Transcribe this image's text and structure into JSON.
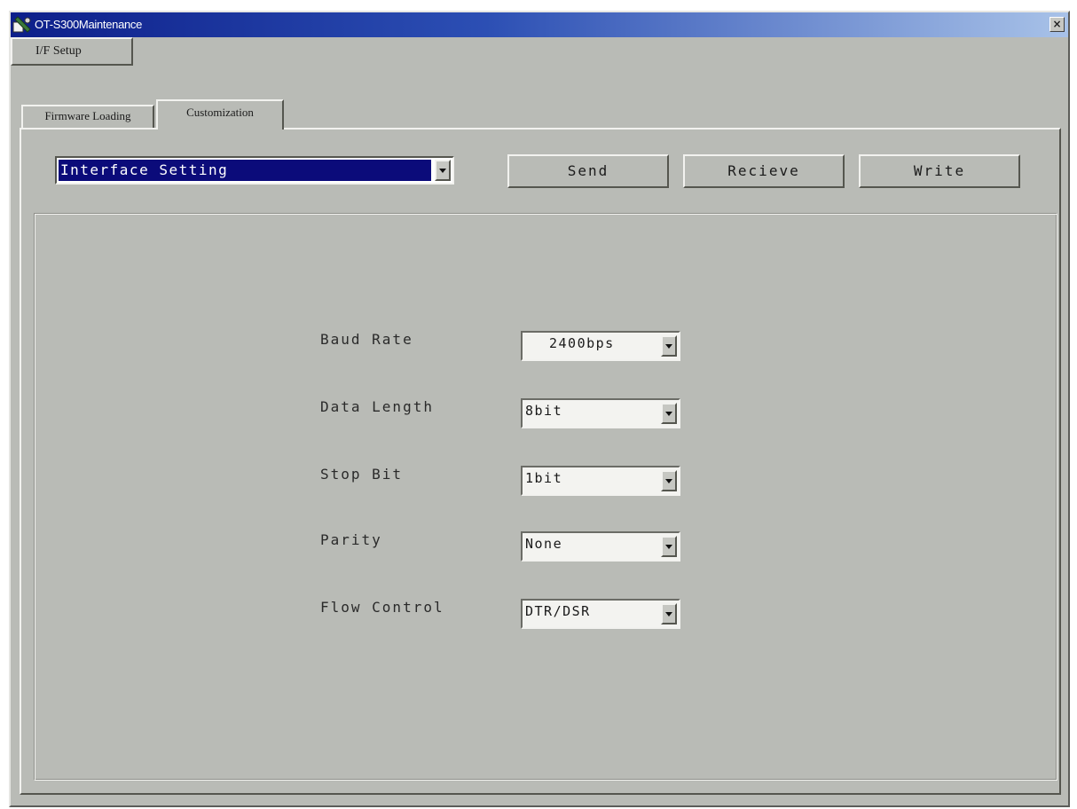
{
  "window": {
    "title": "OT-S300Maintenance",
    "close_label": "×"
  },
  "toolbar": {
    "if_setup_label": "I/F Setup"
  },
  "tabs": [
    {
      "label": "Firmware Loading",
      "selected": false
    },
    {
      "label": "Customization",
      "selected": true
    }
  ],
  "customization": {
    "category_value": "Interface Setting",
    "send_label": "Send",
    "recieve_label": "Recieve",
    "write_label": "Write",
    "fields": [
      {
        "label": "Baud Rate",
        "value": "2400bps"
      },
      {
        "label": "Data Length",
        "value": "8bit"
      },
      {
        "label": "Stop Bit",
        "value": "1bit"
      },
      {
        "label": "Parity",
        "value": "None"
      },
      {
        "label": "Flow Control",
        "value": "DTR/DSR"
      }
    ]
  },
  "colors": {
    "window_face": "#b9bbb6",
    "title_gradient_start": "#0d1f8a",
    "title_gradient_end": "#a8c2e8",
    "selection": "#0b0b7a"
  }
}
